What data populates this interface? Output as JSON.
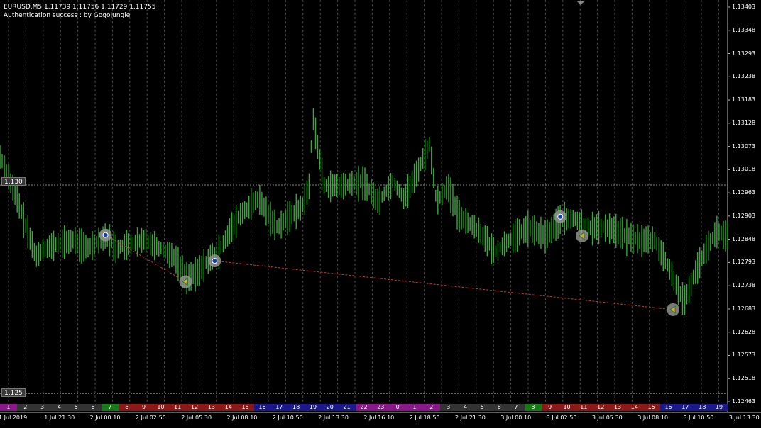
{
  "header": {
    "symbol_line": "EURUSD,M5  1.11739 1.11756 1.11729 1.11755",
    "auth_line": "Authentication success : by GogoJungle"
  },
  "levels": [
    {
      "price": 1.13,
      "label": "1.130"
    },
    {
      "price": 1.125,
      "label": "1.125"
    }
  ],
  "colors": {
    "background": "#000000",
    "candle": "#2fae2f",
    "grid": "#4a4a4a",
    "signal_line": "#c0392b",
    "level_line": "#808080",
    "marker_ring": "#9a9a9a",
    "marker_buy": "#1a3fa8",
    "marker_sell": "#d4a83a"
  },
  "session_bar": {
    "labels": [
      "1",
      "2",
      "3",
      "4",
      "5",
      "6",
      "7",
      "8",
      "9",
      "10",
      "11",
      "12",
      "13",
      "14",
      "15",
      "16",
      "17",
      "18",
      "19",
      "20",
      "21",
      "22",
      "23",
      "0",
      "1",
      "2",
      "3",
      "4",
      "5",
      "6",
      "7",
      "8",
      "9",
      "10",
      "11",
      "12",
      "13",
      "14",
      "15",
      "16",
      "17",
      "18",
      "19"
    ],
    "colors": [
      "#8a1a8a",
      "#333333",
      "#333333",
      "#333333",
      "#333333",
      "#333333",
      "#1a7a1a",
      "#8a1a1a",
      "#8a1a1a",
      "#8a1a1a",
      "#8a1a1a",
      "#8a1a1a",
      "#8a1a1a",
      "#8a1a1a",
      "#8a1a1a",
      "#1a1a8a",
      "#1a1a8a",
      "#1a1a8a",
      "#1a1a8a",
      "#1a1a8a",
      "#1a1a8a",
      "#8a1a8a",
      "#8a1a8a",
      "#8a1a8a",
      "#8a1a8a",
      "#8a1a8a",
      "#333333",
      "#333333",
      "#333333",
      "#333333",
      "#333333",
      "#1a7a1a",
      "#8a1a1a",
      "#8a1a1a",
      "#8a1a1a",
      "#8a1a1a",
      "#8a1a1a",
      "#8a1a1a",
      "#8a1a1a",
      "#1a1a8a",
      "#1a1a8a",
      "#1a1a8a",
      "#1a1a8a"
    ]
  },
  "chart_data": {
    "type": "candlestick",
    "symbol": "EURUSD",
    "timeframe": "M5",
    "ohlc_current": {
      "open": 1.11739,
      "high": 1.11756,
      "low": 1.11729,
      "close": 1.11755
    },
    "ylim": [
      1.12463,
      1.1343
    ],
    "y_ticks": [
      "1.13403",
      "1.13348",
      "1.13293",
      "1.13238",
      "1.13183",
      "1.13128",
      "1.13073",
      "1.13018",
      "1.12963",
      "1.12903",
      "1.12848",
      "1.12793",
      "1.12738",
      "1.12683",
      "1.12628",
      "1.12573",
      "1.12518",
      "1.12463"
    ],
    "x_ticks": [
      "1 Jul 2019",
      "1 Jul 21:30",
      "2 Jul 00:10",
      "2 Jul 02:50",
      "2 Jul 05:30",
      "2 Jul 08:10",
      "2 Jul 10:50",
      "2 Jul 13:30",
      "2 Jul 16:10",
      "2 Jul 18:50",
      "2 Jul 21:30",
      "3 Jul 00:10",
      "3 Jul 02:50",
      "3 Jul 05:30",
      "3 Jul 08:10",
      "3 Jul 10:50",
      "3 Jul 13:30"
    ],
    "price_path": [
      [
        0,
        1.1307
      ],
      [
        0.01,
        1.1303
      ],
      [
        0.025,
        1.1296
      ],
      [
        0.04,
        1.1288
      ],
      [
        0.05,
        1.1283
      ],
      [
        0.06,
        1.1285
      ],
      [
        0.08,
        1.1286
      ],
      [
        0.1,
        1.1287
      ],
      [
        0.12,
        1.1285
      ],
      [
        0.145,
        1.1288
      ],
      [
        0.16,
        1.1285
      ],
      [
        0.2,
        1.1287
      ],
      [
        0.24,
        1.1283
      ],
      [
        0.255,
        1.1278
      ],
      [
        0.27,
        1.1279
      ],
      [
        0.285,
        1.1282
      ],
      [
        0.3,
        1.1284
      ],
      [
        0.315,
        1.1289
      ],
      [
        0.33,
        1.1293
      ],
      [
        0.355,
        1.1297
      ],
      [
        0.38,
        1.129
      ],
      [
        0.4,
        1.1293
      ],
      [
        0.415,
        1.1295
      ],
      [
        0.425,
        1.13
      ],
      [
        0.43,
        1.1317
      ],
      [
        0.445,
        1.13
      ],
      [
        0.47,
        1.13
      ],
      [
        0.5,
        1.1301
      ],
      [
        0.52,
        1.1296
      ],
      [
        0.54,
        1.1301
      ],
      [
        0.555,
        1.1297
      ],
      [
        0.57,
        1.1302
      ],
      [
        0.59,
        1.131
      ],
      [
        0.6,
        1.1296
      ],
      [
        0.615,
        1.13
      ],
      [
        0.63,
        1.1293
      ],
      [
        0.66,
        1.1289
      ],
      [
        0.68,
        1.1284
      ],
      [
        0.7,
        1.1287
      ],
      [
        0.725,
        1.129
      ],
      [
        0.75,
        1.1288
      ],
      [
        0.77,
        1.1292
      ],
      [
        0.79,
        1.1292
      ],
      [
        0.81,
        1.129
      ],
      [
        0.84,
        1.129
      ],
      [
        0.86,
        1.1288
      ],
      [
        0.88,
        1.1287
      ],
      [
        0.9,
        1.1287
      ],
      [
        0.92,
        1.128
      ],
      [
        0.94,
        1.1272
      ],
      [
        0.955,
        1.1279
      ],
      [
        0.97,
        1.1285
      ],
      [
        0.985,
        1.1289
      ],
      [
        1,
        1.1288
      ]
    ],
    "signals": [
      {
        "type": "buy",
        "t": 0.145,
        "price": 1.1288
      },
      {
        "type": "sell",
        "t": 0.255,
        "price": 1.12768
      },
      {
        "type": "buy",
        "t": 0.295,
        "price": 1.12818
      },
      {
        "type": "sell",
        "t": 0.925,
        "price": 1.12701
      },
      {
        "type": "buy",
        "t": 0.77,
        "price": 1.12924
      },
      {
        "type": "sell",
        "t": 0.8,
        "price": 1.12878
      }
    ],
    "signal_lines": [
      [
        0,
        1
      ],
      [
        2,
        3
      ]
    ],
    "grid": true
  }
}
